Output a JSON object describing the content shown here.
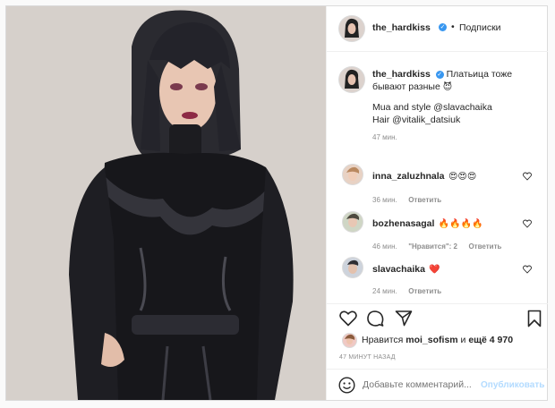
{
  "header": {
    "username": "the_hardkiss",
    "separator": "•",
    "follow_label": "Подписки"
  },
  "caption": {
    "username": "the_hardkiss",
    "text_line1": "Платьица тоже",
    "text_line2": "бывают разные",
    "emoji": "😈",
    "credit_line1": "Mua and style @slavachaika",
    "credit_line2": "Hair @vitalik_datsiuk",
    "time": "47 мин."
  },
  "comments": [
    {
      "username": "inna_zaluzhnala",
      "text": "😍😍😍",
      "time": "36 мин.",
      "reply_label": "Ответить"
    },
    {
      "username": "bozhenasagal",
      "text": "🔥🔥🔥🔥",
      "time": "46 мин.",
      "likes_label": "\"Нравится\": 2",
      "reply_label": "Ответить"
    },
    {
      "username": "slavachaika",
      "text": "❤️",
      "time": "24 мин.",
      "reply_label": "Ответить"
    }
  ],
  "likes": {
    "prefix": "Нравится",
    "user": "moi_sofism",
    "conjunction": "и",
    "count_text": "ещё 4 970"
  },
  "timestamp": "47 МИНУТ НАЗАД",
  "comment_input": {
    "placeholder": "Добавьте комментарий...",
    "publish_label": "Опубликовать"
  },
  "colors": {
    "accent": "#3897f0",
    "publish_disabled": "#b3dbff",
    "heart": "#ed4956"
  },
  "icons": [
    "heart-icon",
    "comment-icon",
    "share-icon",
    "bookmark-icon",
    "emoji-icon",
    "verified-icon"
  ]
}
